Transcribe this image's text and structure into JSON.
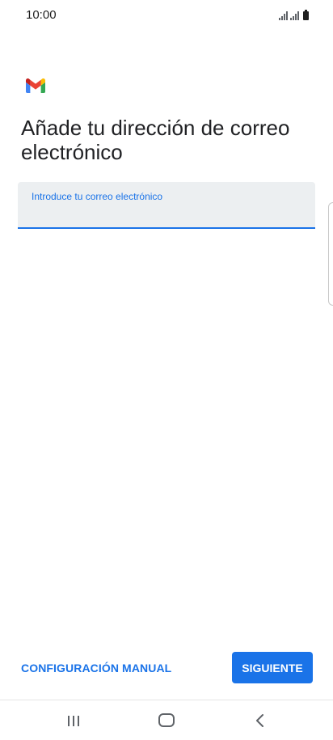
{
  "status_bar": {
    "time": "10:00"
  },
  "brand": {
    "logo_icon": "gmail-icon",
    "colors": {
      "red": "#ea4335",
      "blue": "#4285f4",
      "green": "#34a853",
      "yellow": "#fbbc04",
      "dark_red": "#c5221f"
    }
  },
  "page": {
    "title": "Añade tu dirección de correo electrónico"
  },
  "email_field": {
    "label": "Introduce tu correo electrónico",
    "value": "",
    "placeholder": ""
  },
  "actions": {
    "manual_config_label": "CONFIGURACIÓN MANUAL",
    "next_label": "SIGUIENTE"
  },
  "theme": {
    "accent": "#1a73e8",
    "field_background": "#eceff1"
  },
  "nav_bar": {
    "recents_icon": "recents-icon",
    "home_icon": "home-icon",
    "back_icon": "back-icon"
  }
}
